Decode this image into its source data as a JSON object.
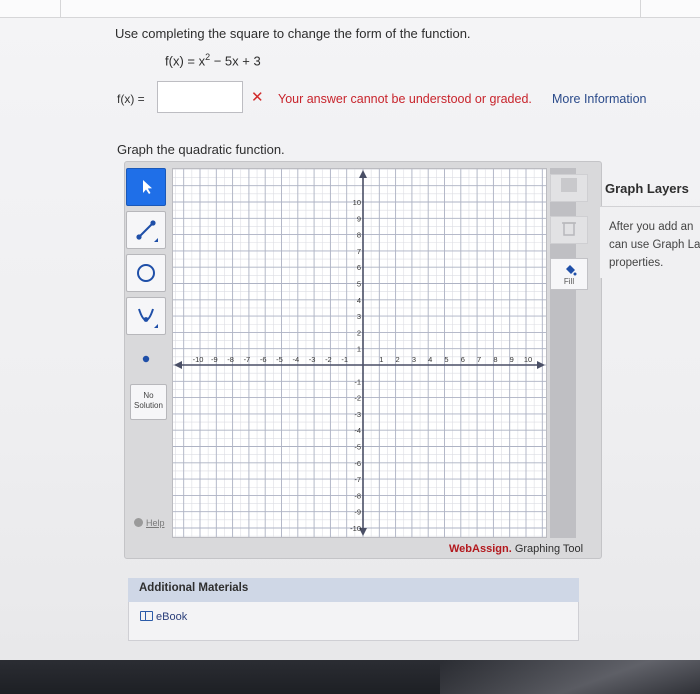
{
  "question": {
    "instruction": "Use completing the square to change the form of the function.",
    "function_lhs": "f(x) = x",
    "function_exp": "2",
    "function_rhs": " − 5x + 3",
    "answer_label": "f(x) =",
    "answer_value": "",
    "error_mark": "✕",
    "error_text": "Your answer cannot be understood or graded.",
    "more_info_link": "More Information",
    "graph_prompt": "Graph the quadratic function."
  },
  "graph_tool": {
    "tools": [
      "pointer-tool",
      "line-tool",
      "circle-tool",
      "parabola-tool",
      "point-tool"
    ],
    "no_solution_line1": "No",
    "no_solution_line2": "Solution",
    "help_label": "Help",
    "fill_label": "Fill",
    "brand_strong": "WebAssign.",
    "brand_rest": " Graphing Tool",
    "x_ticks": [
      "-10",
      "-9",
      "-8",
      "-7",
      "-6",
      "-5",
      "-4",
      "-3",
      "-2",
      "-1",
      "1",
      "2",
      "3",
      "4",
      "5",
      "6",
      "7",
      "8",
      "9",
      "10"
    ],
    "y_ticks": [
      "10",
      "9",
      "8",
      "7",
      "6",
      "5",
      "4",
      "3",
      "2",
      "1",
      "-1",
      "-2",
      "-3",
      "-4",
      "-5",
      "-6",
      "-7",
      "-8",
      "-9",
      "-10"
    ],
    "colors": {
      "active_tool": "#1f6fe8",
      "error": "#c8242c",
      "brand": "#b3181d"
    }
  },
  "graph_layers": {
    "title": "Graph Layers",
    "text": "After you add an\ncan use Graph La\nproperties."
  },
  "additional_materials": {
    "title": "Additional Materials",
    "ebook_label": "eBook"
  }
}
